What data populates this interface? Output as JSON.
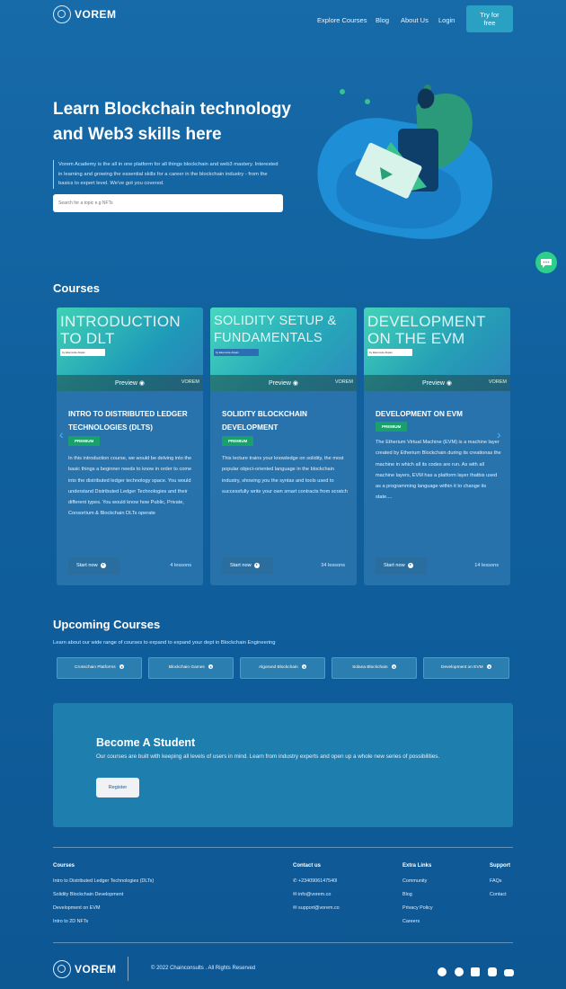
{
  "nav": {
    "brand": "VOREM",
    "links": [
      "Explore Courses",
      "Blog",
      "About Us",
      "Login"
    ],
    "cta": "Try for free"
  },
  "hero": {
    "title_line1": "Learn Blockchain technology",
    "title_line2": "and Web3 skills here",
    "desc": "Vorem Academy is the all in one platform for all things blockchain and web3 mastery. Interested in learning and growing the essential skills for a career in the blockchain industry - from the basics to expert level. We've got you covered.",
    "search_placeholder": "Search for a topic e.g NFTs"
  },
  "courses": {
    "title": "Courses",
    "items": [
      {
        "img_title": "INTRODUCTION TO DLT",
        "img_sub": "by Ekemode Akpan",
        "preview": "Preview",
        "img_brand": "VOREM",
        "title": "INTRO TO DISTRIBUTED LEDGER TECHNOLOGIES (DLTS)",
        "badge": "PREMIUM",
        "desc": "In this introduction course, we would be delving into the basic things a beginner needs to know in order to come into the distributed ledger technology space. You would understand Distributed Ledger Technologies and their different types. You would know how Public, Private, Consortium & Blockchain DLTs operate",
        "start": "Start now",
        "lessons": "4 lessons"
      },
      {
        "img_title": "SOLIDITY SETUP & FUNDAMENTALS",
        "img_sub": "by Ekemode Akpan",
        "preview": "Preview",
        "img_brand": "VOREM",
        "title": "SOLIDITY BLOCKCHAIN DEVELOPMENT",
        "badge": "PREMIUM",
        "desc": "This lecture trains your knowledge on solidity, the most popular object-oriented language in the blockchain industry, showing you the syntax and tools used to successfully write your own smart contracts from scratch",
        "start": "Start now",
        "lessons": "34 lessons"
      },
      {
        "img_title": "DEVELOPMENT ON THE EVM",
        "img_sub": "by Ekemode Akpan",
        "preview": "Preview",
        "img_brand": "VOREM",
        "title": "DEVELOPMENT ON EVM",
        "badge": "PREMIUM",
        "desc": "The Etherium Virtual Machine (EVM) is a machine layer created by Etherium Blockchain during its creationas the machine in which all its codes are run. As with all machine layers, EVM has a platform layer thatbis used as a programming language within it to change its state....",
        "start": "Start now",
        "lessons": "14 lessons"
      }
    ]
  },
  "upcoming": {
    "title": "Upcoming Courses",
    "subtitle": "Learn about our wide range of courses to expand to expand your dept in Blockchain Engineering",
    "items": [
      "Crosschain Platforms",
      "Blockchain Games",
      "Algorand Blockchain",
      "Solana Blockchain",
      "Development on EVM"
    ]
  },
  "student": {
    "title": "Become A Student",
    "desc": "Our courses are built with keeping all levels of users in mind. Learn from industry experts and open up a whole new series of possibilities.",
    "button": "Register"
  },
  "footer": {
    "courses_title": "Courses",
    "courses": [
      "Intro to Distributed Ledger Technologies (DLTs)",
      "Solidity Blockchain Development",
      "Development on EVM",
      "Intro to 2D NFTs"
    ],
    "contact_title": "Contact us",
    "contact": [
      "+2340906147540l",
      "info@vorem.co",
      "support@vorem.co"
    ],
    "extra_title": "Extra Links",
    "extra": [
      "Community",
      "Blog",
      "Privacy Policy",
      "Careers"
    ],
    "support_title": "Support",
    "support": [
      "FAQs",
      "Contact"
    ],
    "brand": "VOREM",
    "copyright": "© 2022 Chainconsults . All Rights Reserved"
  },
  "colors": {
    "bg": "#10609e",
    "accent": "#2aa0c2",
    "premium": "#1aa06a",
    "chat": "#2ecf8a"
  },
  "icons": [
    "eye-icon",
    "play-circle-icon",
    "arrow-right-icon",
    "chevron-left-icon",
    "chevron-right-icon",
    "chat-icon",
    "phone-icon",
    "mail-icon",
    "facebook-icon",
    "twitter-icon",
    "linkedin-icon",
    "instagram-icon",
    "youtube-icon"
  ]
}
